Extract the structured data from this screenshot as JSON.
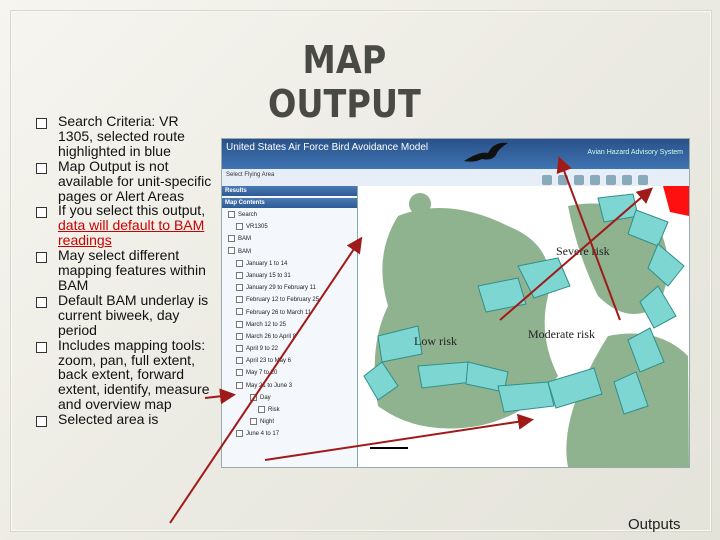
{
  "slide": {
    "title": "MAP OUTPUT",
    "footer": "Outputs",
    "bullets": [
      {
        "pre": "Search Criteria: VR 1305, selected route highlighted in blue",
        "red": "",
        "post": ""
      },
      {
        "pre": "Map Output is not available for unit-specific pages or Alert Areas",
        "red": "",
        "post": ""
      },
      {
        "pre": "If you select this output, ",
        "red": "data will default to BAM readings",
        "post": ""
      },
      {
        "pre": "May select different mapping features within BAM",
        "red": "",
        "post": ""
      },
      {
        "pre": "Default BAM underlay is current biweek, day period",
        "red": "",
        "post": ""
      },
      {
        "pre": "Includes mapping tools: zoom, pan, full extent, back extent, forward extent, identify, measure and overview map",
        "red": "",
        "post": ""
      },
      {
        "pre": "Selected area is",
        "red": "",
        "post": ""
      }
    ]
  },
  "screenshot": {
    "app_title": "United States Air Force Bird Avoidance Model",
    "app_subtitle": "Avian Hazard Advisory System",
    "toolbar_label": "Select Flying Area",
    "results_label": "Results",
    "map_contents_label": "Map Contents",
    "tree": [
      {
        "level": 1,
        "text": "Search"
      },
      {
        "level": 2,
        "text": "VR1305"
      },
      {
        "level": 1,
        "text": "BAM"
      },
      {
        "level": 1,
        "text": "BAM"
      },
      {
        "level": 2,
        "text": "January 1 to 14"
      },
      {
        "level": 2,
        "text": "January 15 to 31"
      },
      {
        "level": 2,
        "text": "January 29 to February 11"
      },
      {
        "level": 2,
        "text": "February 12 to February 25"
      },
      {
        "level": 2,
        "text": "February 26 to March 11"
      },
      {
        "level": 2,
        "text": "March 12 to 25"
      },
      {
        "level": 2,
        "text": "March 26 to April 8"
      },
      {
        "level": 2,
        "text": "April 9 to 22"
      },
      {
        "level": 2,
        "text": "April 23 to May 6"
      },
      {
        "level": 2,
        "text": "May 7 to 20"
      },
      {
        "level": 2,
        "text": "May 21 to June 3"
      },
      {
        "level": 3,
        "text": "Day"
      },
      {
        "level": 4,
        "text": "Risk"
      },
      {
        "level": 3,
        "text": "Night"
      },
      {
        "level": 2,
        "text": "June 4 to 17"
      }
    ],
    "map_labels": {
      "severe": "Severe risk",
      "moderate": "Moderate risk",
      "low": "Low risk"
    },
    "colors": {
      "low": "#8fb38f",
      "moderate": "#7ed6d2",
      "severe": "#ff1010",
      "header": "#2f5f9a"
    }
  }
}
